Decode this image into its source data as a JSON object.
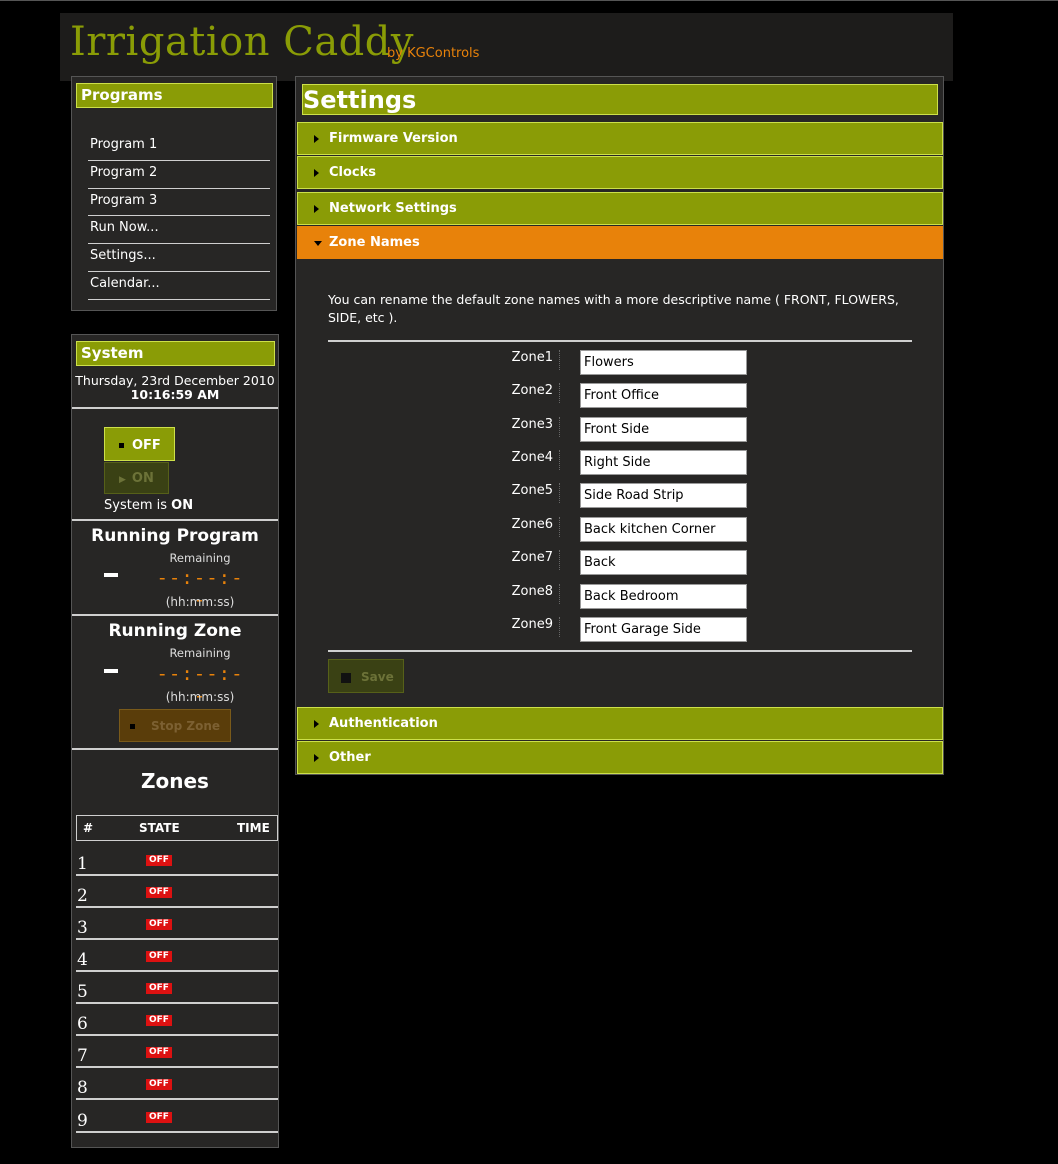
{
  "app": {
    "title": "Irrigation Caddy",
    "subtitle": "by KGControls"
  },
  "programs": {
    "heading": "Programs",
    "items": [
      "Program 1",
      "Program 2",
      "Program 3",
      "Run Now...",
      "Settings...",
      "Calendar..."
    ]
  },
  "system": {
    "heading": "System",
    "date": "Thursday, 23rd December 2010",
    "time": "10:16:59 AM",
    "off_label": "OFF",
    "on_label": "ON",
    "status_prefix": "System is",
    "status_value": "ON"
  },
  "running_program": {
    "title": "Running Program",
    "name": "-",
    "remaining_label": "Remaining",
    "clock": "--:--:--",
    "format": "(hh:mm:ss)"
  },
  "running_zone": {
    "title": "Running Zone",
    "name": "-",
    "remaining_label": "Remaining",
    "clock": "--:--:--",
    "format": "(hh:mm:ss)",
    "stop_label": "Stop Zone"
  },
  "zones": {
    "title": "Zones",
    "headers": [
      "#",
      "STATE",
      "TIME"
    ],
    "rows": [
      {
        "num": "1",
        "state": "OFF"
      },
      {
        "num": "2",
        "state": "OFF"
      },
      {
        "num": "3",
        "state": "OFF"
      },
      {
        "num": "4",
        "state": "OFF"
      },
      {
        "num": "5",
        "state": "OFF"
      },
      {
        "num": "6",
        "state": "OFF"
      },
      {
        "num": "7",
        "state": "OFF"
      },
      {
        "num": "8",
        "state": "OFF"
      },
      {
        "num": "9",
        "state": "OFF"
      }
    ]
  },
  "settings": {
    "title": "Settings",
    "sections": [
      "Firmware Version",
      "Clocks",
      "Network Settings",
      "Zone Names",
      "Authentication",
      "Other"
    ],
    "zone_names": {
      "description": "You can rename the default zone names with a more descriptive name ( FRONT, FLOWERS, SIDE, etc ).",
      "fields": [
        {
          "label": "Zone1",
          "value": "Flowers"
        },
        {
          "label": "Zone2",
          "value": "Front Office"
        },
        {
          "label": "Zone3",
          "value": "Front Side"
        },
        {
          "label": "Zone4",
          "value": "Right Side"
        },
        {
          "label": "Zone5",
          "value": "Side Road Strip"
        },
        {
          "label": "Zone6",
          "value": "Back kitchen Corner"
        },
        {
          "label": "Zone7",
          "value": "Back"
        },
        {
          "label": "Zone8",
          "value": "Back Bedroom"
        },
        {
          "label": "Zone9",
          "value": "Front Garage Side"
        }
      ],
      "save_label": "Save"
    }
  },
  "colors": {
    "accent_green": "#8a9c06",
    "accent_orange": "#e8820a",
    "panel_bg": "#272625",
    "off_badge": "#dd1111"
  }
}
